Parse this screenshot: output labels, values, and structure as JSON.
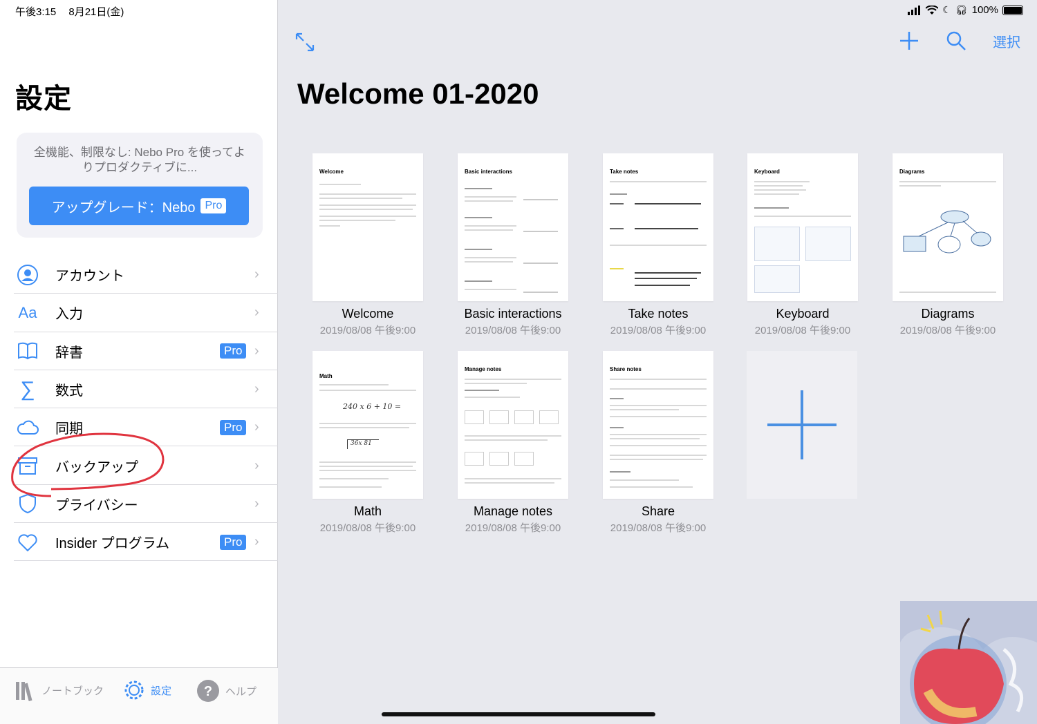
{
  "status_bar": {
    "time": "午後3:15",
    "date": "8月21日(金)",
    "battery": "100%"
  },
  "sidebar": {
    "title": "設定",
    "promo": {
      "text": "全機能、制限なし: Nebo Pro を使ってよりプロダクティブに...",
      "button_label": "アップグレード：Nebo",
      "button_chip": "Pro"
    },
    "items": [
      {
        "label": "アカウント",
        "icon": "account-icon",
        "pro": ""
      },
      {
        "label": "入力",
        "icon": "input-icon",
        "pro": ""
      },
      {
        "label": "辞書",
        "icon": "dictionary-icon",
        "pro": "Pro"
      },
      {
        "label": "数式",
        "icon": "math-icon",
        "pro": ""
      },
      {
        "label": "同期",
        "icon": "cloud-icon",
        "pro": "Pro"
      },
      {
        "label": "バックアップ",
        "icon": "backup-icon",
        "pro": ""
      },
      {
        "label": "プライバシー",
        "icon": "privacy-icon",
        "pro": ""
      },
      {
        "label": "Insider プログラム",
        "icon": "heart-icon",
        "pro": "Pro"
      }
    ]
  },
  "tabbar": {
    "notebooks": "ノートブック",
    "settings": "設定",
    "help": "ヘルプ"
  },
  "header": {
    "select_label": "選択",
    "title": "Welcome 01-2020"
  },
  "notes": [
    {
      "name": "Welcome",
      "date": "2019/08/08 午後9:00",
      "thumb_title": "Welcome"
    },
    {
      "name": "Basic interactions",
      "date": "2019/08/08 午後9:00",
      "thumb_title": "Basic interactions"
    },
    {
      "name": "Take notes",
      "date": "2019/08/08 午後9:00",
      "thumb_title": "Take notes"
    },
    {
      "name": "Keyboard",
      "date": "2019/08/08 午後9:00",
      "thumb_title": "Keyboard"
    },
    {
      "name": "Diagrams",
      "date": "2019/08/08 午後9:00",
      "thumb_title": "Diagrams"
    },
    {
      "name": "Math",
      "date": "2019/08/08 午後9:00",
      "thumb_title": "Math"
    },
    {
      "name": "Manage notes",
      "date": "2019/08/08 午後9:00",
      "thumb_title": "Manage notes"
    },
    {
      "name": "Share",
      "date": "2019/08/08 午後9:00",
      "thumb_title": "Share notes"
    }
  ],
  "colors": {
    "accent": "#3d8df5",
    "annotation": "#e0343f"
  }
}
